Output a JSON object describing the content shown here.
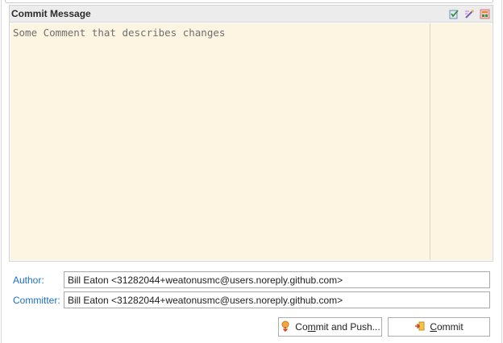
{
  "commit_section": {
    "title": "Commit Message",
    "message": "Some Comment that describes changes",
    "tools": [
      "spell-check-icon",
      "format-icon",
      "staging-icon"
    ]
  },
  "author": {
    "label": "Author:",
    "value": "Bill Eaton <31282044+weatonusmc@users.noreply.github.com>"
  },
  "committer": {
    "label": "Committer:",
    "value": "Bill Eaton <31282044+weatonusmc@users.noreply.github.com>"
  },
  "buttons": {
    "commit_and_push": {
      "before": "Co",
      "mnemonic": "m",
      "after": "mit and Push..."
    },
    "commit": {
      "before": "",
      "mnemonic": "C",
      "after": "ommit"
    }
  },
  "colors": {
    "editor_background": "#fdf5e1",
    "label_blue": "#1a6fc4",
    "header_background": "#ececec"
  }
}
